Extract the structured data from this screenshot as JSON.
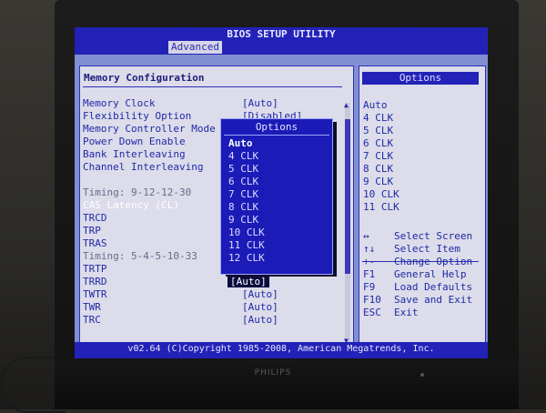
{
  "monitor": {
    "brand": "PHILIPS"
  },
  "bios": {
    "title": "BIOS SETUP UTILITY",
    "active_tab": "Advanced",
    "section_title": "Memory Configuration",
    "settings": [
      {
        "label": "Memory Clock",
        "value": "[Auto]"
      },
      {
        "label": "Flexibility Option",
        "value": "[Disabled]"
      },
      {
        "label": "Memory Controller Mode",
        "value": ""
      },
      {
        "label": "Power Down Enable",
        "value": ""
      },
      {
        "label": "Bank Interleaving",
        "value": ""
      },
      {
        "label": "Channel Interleaving",
        "value": ""
      }
    ],
    "timing_group1": "Timing: 9-12-12-30",
    "timing_items1": [
      "CAS Latency (CL)",
      "TRCD",
      "TRP",
      "TRAS"
    ],
    "timing_group2": "Timing: 5-4-5-10-33",
    "timing_items2": [
      {
        "label": "TRTP",
        "value": ""
      },
      {
        "label": "TRRD",
        "value": "[Auto]"
      },
      {
        "label": "TWTR",
        "value": "[Auto]"
      },
      {
        "label": "TWR",
        "value": "[Auto]"
      },
      {
        "label": "TRC",
        "value": "[Auto]"
      }
    ],
    "popup": {
      "title": "Options",
      "options": [
        "Auto",
        "4 CLK",
        "5 CLK",
        "6 CLK",
        "7 CLK",
        "8 CLK",
        "9 CLK",
        "10 CLK",
        "11 CLK",
        "12 CLK"
      ]
    },
    "options_panel": {
      "header": "Options",
      "options": [
        "Auto",
        "4 CLK",
        "5 CLK",
        "6 CLK",
        "7 CLK",
        "8 CLK",
        "9 CLK",
        "10 CLK",
        "11 CLK"
      ]
    },
    "help": [
      {
        "key": "↔",
        "desc": "Select Screen"
      },
      {
        "key": "↑↓",
        "desc": "Select Item"
      },
      {
        "key": "+-",
        "desc": "Change Option"
      },
      {
        "key": "F1",
        "desc": "General Help"
      },
      {
        "key": "F9",
        "desc": "Load Defaults"
      },
      {
        "key": "F10",
        "desc": "Save and Exit"
      },
      {
        "key": "ESC",
        "desc": "Exit"
      }
    ],
    "footer": "v02.64 (C)Copyright 1985-2008, American Megatrends, Inc."
  }
}
